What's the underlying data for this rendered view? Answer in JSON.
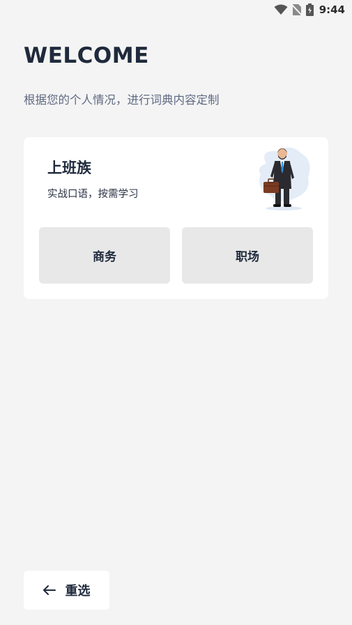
{
  "status_bar": {
    "time": "9:44",
    "icons": [
      "wifi-icon",
      "no-sim-icon",
      "battery-charging-icon"
    ]
  },
  "header": {
    "title": "WELCOME",
    "subtitle": "根据您的个人情况，进行词典内容定制"
  },
  "profile_card": {
    "title": "上班族",
    "description": "实战口语，按需学习",
    "illustration": "businessman-with-briefcase",
    "options": [
      {
        "label": "商务"
      },
      {
        "label": "职场"
      }
    ]
  },
  "footer": {
    "reselect_label": "重选",
    "reselect_icon": "arrow-left-icon"
  },
  "colors": {
    "background": "#f4f4f4",
    "card": "#ffffff",
    "option_bg": "#e8e8e8",
    "text_primary": "#1f2a3c",
    "text_secondary": "#5f6a82"
  }
}
